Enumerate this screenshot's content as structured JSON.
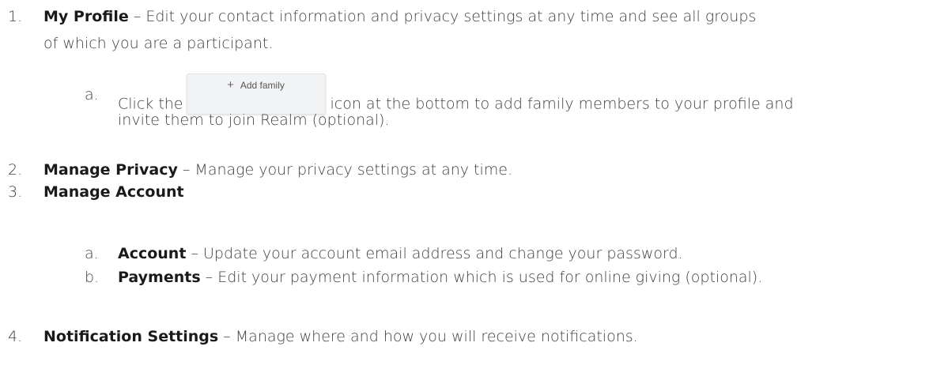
{
  "items": [
    {
      "number": "1.",
      "title": "My Profile",
      "desc_line1": " – Edit your contact information and privacy settings at any time and see all groups",
      "desc_line2": "of which you are a participant.",
      "subitems": [
        {
          "letter": "a.",
          "text_before": "Click the",
          "button_label": "Add family",
          "button_icon": "plus-icon",
          "text_after": "icon at the bottom to add family members to your profile and",
          "text_line2": "invite them to join Realm (optional)."
        }
      ]
    },
    {
      "number": "2.",
      "title": "Manage Privacy",
      "desc": " – Manage your privacy settings at any time."
    },
    {
      "number": "3.",
      "title": "Manage Account",
      "subitems": [
        {
          "letter": "a.",
          "title": "Account",
          "desc": " – Update your account email address and change your password."
        },
        {
          "letter": "b.",
          "title": "Payments",
          "desc": " – Edit your payment information which is used for online giving (optional)."
        }
      ]
    },
    {
      "number": "4.",
      "title": "Notification Settings",
      "desc": " – Manage where and how you will receive notifications."
    }
  ]
}
